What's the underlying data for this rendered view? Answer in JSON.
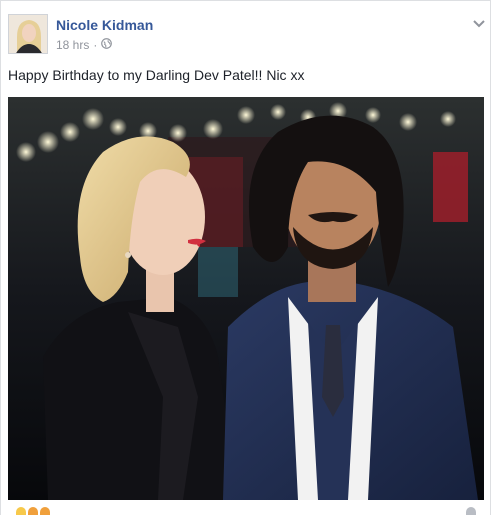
{
  "post": {
    "author_name": "Nicole Kidman",
    "timestamp": "18 hrs",
    "privacy_icon": "globe-icon",
    "menu_icon": "chevron-down-icon",
    "message": "Happy Birthday to my Darling Dev Patel!! Nic xx"
  },
  "colors": {
    "author_link": "#365899",
    "meta_text": "#90949c",
    "body_text": "#1d2129"
  }
}
